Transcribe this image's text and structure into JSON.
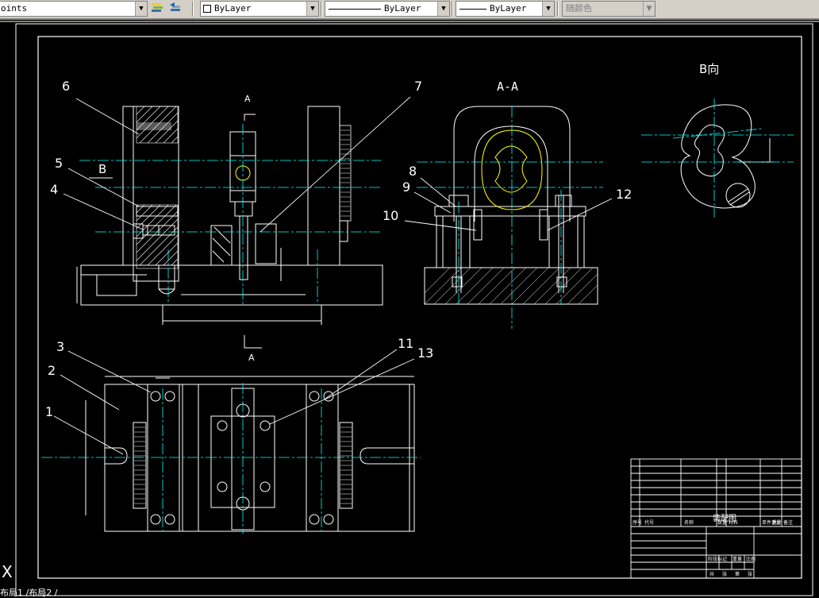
{
  "toolbar": {
    "linetype_combo": "oints",
    "layer_color_combo": "ByLayer",
    "linetype_byLayer": "ByLayer",
    "lineweight_byLayer": "ByLayer",
    "plotstyle_combo": "随颜色"
  },
  "drawing": {
    "view_marker_top": "A",
    "view_marker_bottom": "A",
    "section_title": "A-A",
    "view_b_title": "B向",
    "view_b_marker": "B",
    "part_numbers": [
      "1",
      "2",
      "3",
      "4",
      "5",
      "6",
      "7",
      "8",
      "9",
      "10",
      "11",
      "12",
      "13"
    ],
    "title_block": {
      "name": "装配图",
      "header_cells": [
        "序号",
        "代号",
        "名称",
        "数量",
        "材料",
        "单件重量",
        "总计",
        "备注"
      ],
      "small_labels": [
        "阶段标记",
        "重量",
        "比例",
        "共",
        "张",
        "第",
        "张"
      ]
    }
  },
  "command_line": "布局1 /布局2 /",
  "colors": {
    "background": "#000000",
    "outline": "#ffffff",
    "centerline": "#00ffff",
    "hidden": "#ffff00",
    "toolbar": "#d4d0c8"
  }
}
